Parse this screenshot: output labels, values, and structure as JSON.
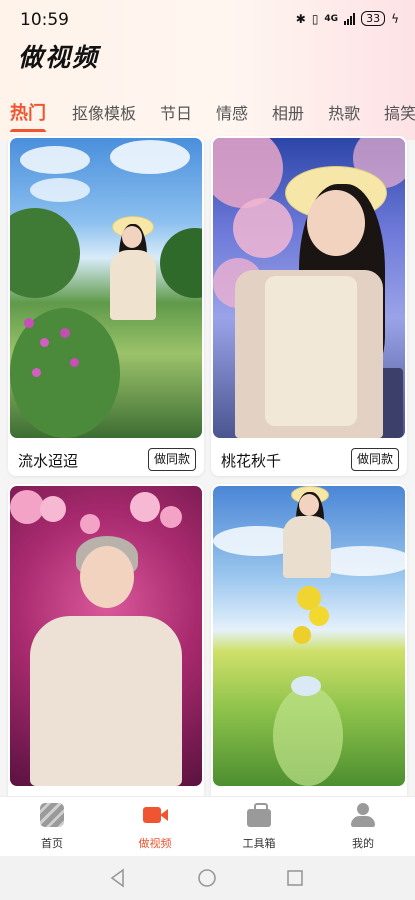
{
  "status_bar": {
    "time": "10:59",
    "network": "4G",
    "battery": "33"
  },
  "header": {
    "title": "做视频"
  },
  "tabs": [
    {
      "label": "热门",
      "active": true
    },
    {
      "label": "抠像模板"
    },
    {
      "label": "节日"
    },
    {
      "label": "情感"
    },
    {
      "label": "相册"
    },
    {
      "label": "热歌"
    },
    {
      "label": "搞笑"
    }
  ],
  "cards": [
    {
      "name": "流水迢迢",
      "button": "做同款"
    },
    {
      "name": "桃花秋千",
      "button": "做同款"
    },
    {
      "name": "",
      "button": ""
    },
    {
      "name": "",
      "button": ""
    }
  ],
  "bottom_nav": [
    {
      "label": "首页",
      "icon": "home-icon"
    },
    {
      "label": "做视频",
      "icon": "video-camera-icon",
      "active": true
    },
    {
      "label": "工具箱",
      "icon": "toolbox-icon"
    },
    {
      "label": "我的",
      "icon": "profile-icon"
    }
  ],
  "colors": {
    "accent": "#ee5530"
  }
}
